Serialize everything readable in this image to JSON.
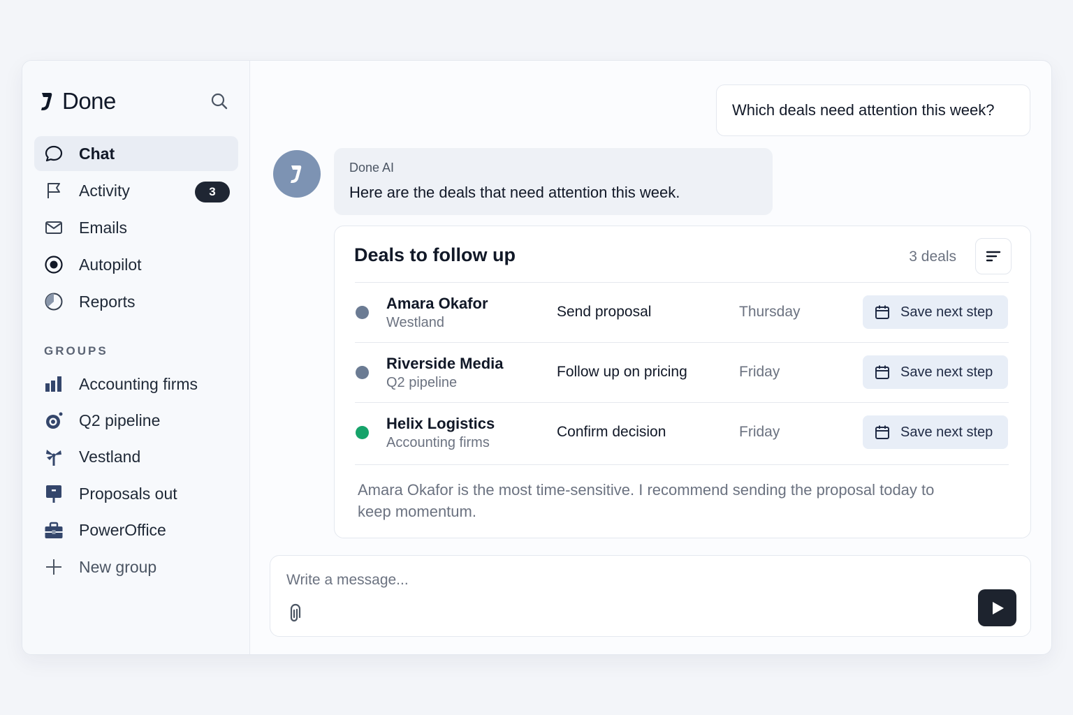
{
  "app": {
    "name": "Done"
  },
  "sidebar": {
    "nav": [
      {
        "label": "Chat",
        "icon": "chat-bubble-icon",
        "active": true
      },
      {
        "label": "Activity",
        "icon": "flag-icon",
        "badge": "3"
      },
      {
        "label": "Emails",
        "icon": "mail-icon"
      },
      {
        "label": "Autopilot",
        "icon": "target-icon"
      },
      {
        "label": "Reports",
        "icon": "pie-chart-icon"
      }
    ],
    "groups_title": "GROUPS",
    "groups": [
      {
        "label": "Accounting firms",
        "icon": "bar-chart-icon"
      },
      {
        "label": "Q2 pipeline",
        "icon": "ring-icon"
      },
      {
        "label": "Vestland",
        "icon": "windmill-icon"
      },
      {
        "label": "Proposals out",
        "icon": "signpost-icon"
      },
      {
        "label": "PowerOffice",
        "icon": "briefcase-icon"
      }
    ],
    "new_group_label": "New group"
  },
  "chat": {
    "user_message": "Which deals need attention this week?",
    "ai_name": "Done AI",
    "ai_message": "Here are the deals that need attention this week."
  },
  "deals": {
    "title": "Deals to follow up",
    "count_label": "3 deals",
    "rows": [
      {
        "name": "Amara Okafor",
        "group": "Westland",
        "action": "Send proposal",
        "when": "Thursday",
        "button": "Save next step",
        "status_color": "#6b7b93"
      },
      {
        "name": "Riverside Media",
        "group": "Q2 pipeline",
        "action": "Follow up on pricing",
        "when": "Friday",
        "button": "Save next step",
        "status_color": "#6b7b93"
      },
      {
        "name": "Helix Logistics",
        "group": "Accounting firms",
        "action": "Confirm decision",
        "when": "Friday",
        "button": "Save next step",
        "status_color": "#16a36a"
      }
    ],
    "summary": "Amara Okafor is the most time-sensitive. I recommend sending the proposal today to keep momentum."
  },
  "composer": {
    "placeholder": "Write a message..."
  },
  "colors": {
    "accent_dark": "#1d232e",
    "avatar": "#7d93b3",
    "button_bg": "#e8eef7"
  }
}
